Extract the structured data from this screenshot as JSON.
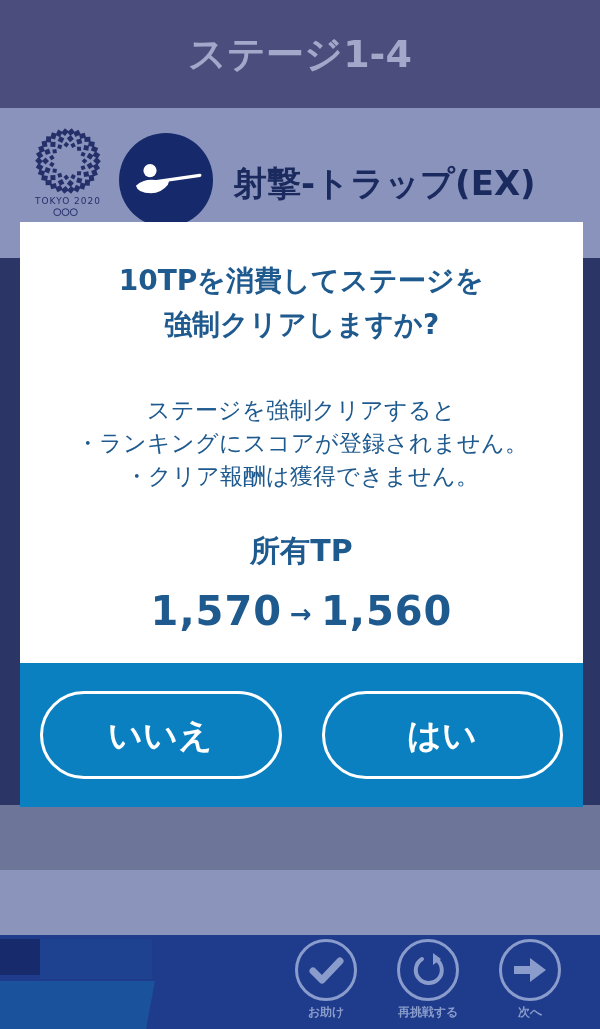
{
  "header": {
    "title": "ステージ1-4"
  },
  "event": {
    "logo_text": "TOKYO 2020",
    "name": "射撃-トラップ(EX)"
  },
  "dialog": {
    "title_lines": [
      "10TPを消費してステージを",
      "強制クリアしますか?"
    ],
    "intro": "ステージを強制クリアすると",
    "notes": [
      "・ランキングにスコアが登録されません。",
      "・クリア報酬は獲得できません。"
    ],
    "tp_label": "所有TP",
    "tp_before": "1,570",
    "tp_arrow": "→",
    "tp_after": "1,560",
    "buttons": [
      {
        "label": "いいえ"
      },
      {
        "label": "はい"
      }
    ]
  },
  "toolbar": [
    {
      "kind": "check",
      "label": "お助け"
    },
    {
      "kind": "retry",
      "label": "再挑戦する"
    },
    {
      "kind": "next",
      "label": "次へ"
    }
  ]
}
